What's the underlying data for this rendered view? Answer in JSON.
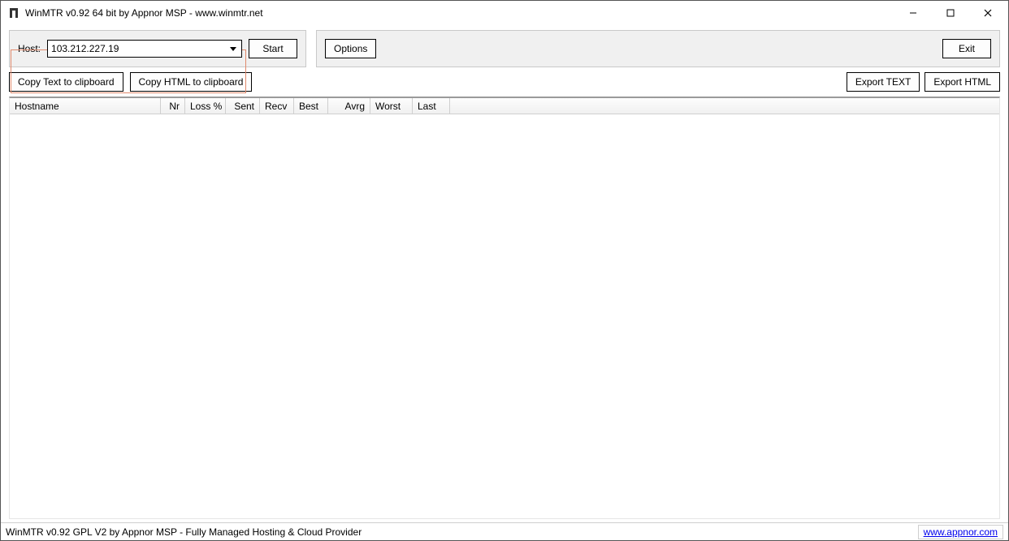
{
  "window": {
    "title": "WinMTR v0.92 64 bit by Appnor MSP - www.winmtr.net"
  },
  "toolbar": {
    "host_label": "Host:",
    "host_value": "103.212.227.19",
    "start_label": "Start",
    "options_label": "Options",
    "exit_label": "Exit"
  },
  "actions": {
    "copy_text_label": "Copy Text to clipboard",
    "copy_html_label": "Copy HTML to clipboard",
    "export_text_label": "Export TEXT",
    "export_html_label": "Export HTML"
  },
  "grid": {
    "columns": {
      "hostname": "Hostname",
      "nr": "Nr",
      "loss": "Loss %",
      "sent": "Sent",
      "recv": "Recv",
      "best": "Best",
      "avrg": "Avrg",
      "worst": "Worst",
      "last": "Last"
    },
    "rows": []
  },
  "status": {
    "text": "WinMTR v0.92 GPL V2 by Appnor MSP - Fully Managed Hosting & Cloud Provider",
    "link_text": "www.appnor.com"
  }
}
